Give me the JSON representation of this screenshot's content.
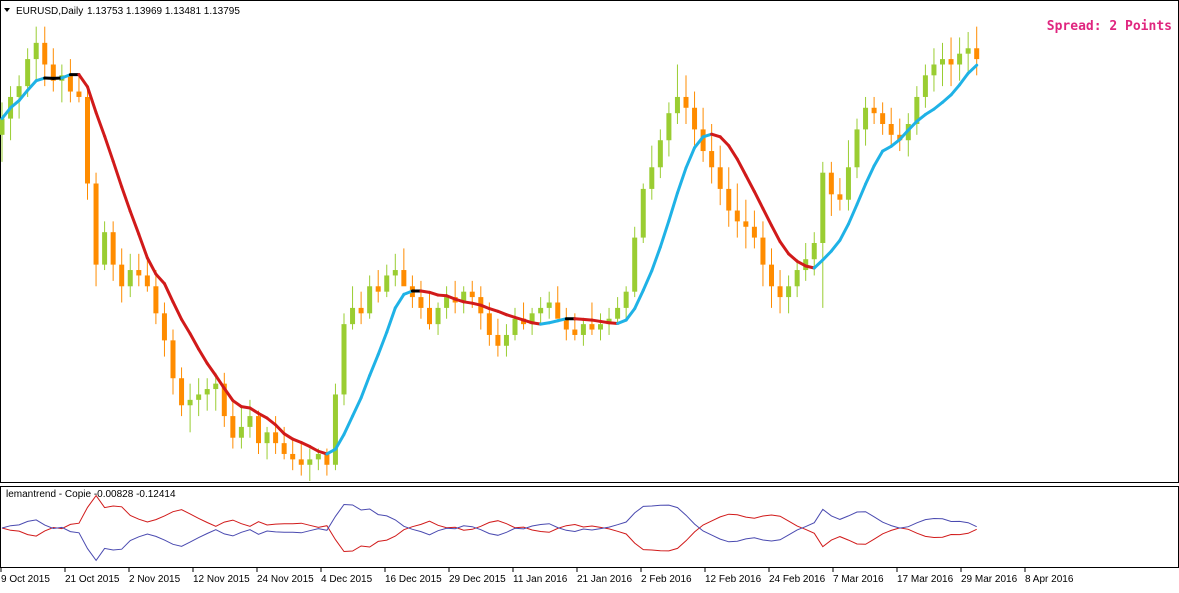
{
  "main_title": "EURUSD,Daily",
  "ohlc": "1.13753 1.13969 1.13481 1.13795",
  "spread_label": "Spread: 2 Points",
  "indicator_label": "lemantrend - Copie -0.00828 -0.12414",
  "x_ticks": [
    "9 Oct 2015",
    "21 Oct 2015",
    "2 Nov 2015",
    "12 Nov 2015",
    "24 Nov 2015",
    "4 Dec 2015",
    "16 Dec 2015",
    "29 Dec 2015",
    "11 Jan 2016",
    "21 Jan 2016",
    "2 Feb 2016",
    "12 Feb 2016",
    "24 Feb 2016",
    "7 Mar 2016",
    "17 Mar 2016",
    "29 Mar 2016",
    "8 Apr 2016"
  ],
  "colors": {
    "bull": "#9acd32",
    "bear": "#ff8c00",
    "ma_up": "#1fb2e6",
    "ma_down": "#d11a1a",
    "ma_flat": "#000000",
    "ind_red": "#d11a1a",
    "ind_blue": "#4a4ab0"
  },
  "chart_data": {
    "type": "candlestick",
    "symbol": "EURUSD",
    "timeframe": "Daily",
    "price_range": [
      1.06,
      1.148
    ],
    "candles": [
      [
        1.124,
        1.13,
        1.119,
        1.127
      ],
      [
        1.127,
        1.133,
        1.123,
        1.131
      ],
      [
        1.131,
        1.135,
        1.127,
        1.133
      ],
      [
        1.133,
        1.14,
        1.131,
        1.138
      ],
      [
        1.138,
        1.144,
        1.134,
        1.141
      ],
      [
        1.141,
        1.144,
        1.133,
        1.137
      ],
      [
        1.137,
        1.14,
        1.132,
        1.134
      ],
      [
        1.134,
        1.137,
        1.13,
        1.135
      ],
      [
        1.135,
        1.138,
        1.13,
        1.132
      ],
      [
        1.132,
        1.135,
        1.13,
        1.131
      ],
      [
        1.131,
        1.133,
        1.112,
        1.115
      ],
      [
        1.115,
        1.117,
        1.096,
        1.1
      ],
      [
        1.1,
        1.108,
        1.099,
        1.106
      ],
      [
        1.106,
        1.108,
        1.097,
        1.1
      ],
      [
        1.1,
        1.103,
        1.093,
        1.096
      ],
      [
        1.096,
        1.102,
        1.094,
        1.099
      ],
      [
        1.099,
        1.102,
        1.096,
        1.098
      ],
      [
        1.098,
        1.101,
        1.095,
        1.096
      ],
      [
        1.096,
        1.099,
        1.089,
        1.091
      ],
      [
        1.091,
        1.093,
        1.083,
        1.086
      ],
      [
        1.086,
        1.088,
        1.076,
        1.079
      ],
      [
        1.079,
        1.081,
        1.072,
        1.074
      ],
      [
        1.074,
        1.078,
        1.069,
        1.075
      ],
      [
        1.075,
        1.079,
        1.072,
        1.076
      ],
      [
        1.076,
        1.079,
        1.073,
        1.077
      ],
      [
        1.077,
        1.08,
        1.073,
        1.078
      ],
      [
        1.078,
        1.08,
        1.07,
        1.072
      ],
      [
        1.072,
        1.075,
        1.066,
        1.068
      ],
      [
        1.068,
        1.074,
        1.066,
        1.07
      ],
      [
        1.07,
        1.075,
        1.068,
        1.072
      ],
      [
        1.072,
        1.073,
        1.065,
        1.067
      ],
      [
        1.067,
        1.07,
        1.064,
        1.069
      ],
      [
        1.069,
        1.072,
        1.065,
        1.067
      ],
      [
        1.067,
        1.07,
        1.064,
        1.065
      ],
      [
        1.065,
        1.068,
        1.062,
        1.064
      ],
      [
        1.064,
        1.067,
        1.061,
        1.063
      ],
      [
        1.063,
        1.066,
        1.06,
        1.064
      ],
      [
        1.064,
        1.066,
        1.062,
        1.065
      ],
      [
        1.065,
        1.066,
        1.061,
        1.063
      ],
      [
        1.063,
        1.078,
        1.062,
        1.076
      ],
      [
        1.076,
        1.091,
        1.074,
        1.089
      ],
      [
        1.089,
        1.096,
        1.088,
        1.092
      ],
      [
        1.092,
        1.095,
        1.089,
        1.091
      ],
      [
        1.091,
        1.098,
        1.09,
        1.096
      ],
      [
        1.096,
        1.099,
        1.093,
        1.095
      ],
      [
        1.095,
        1.1,
        1.094,
        1.098
      ],
      [
        1.098,
        1.102,
        1.096,
        1.099
      ],
      [
        1.099,
        1.103,
        1.097,
        1.096
      ],
      [
        1.096,
        1.098,
        1.092,
        1.094
      ],
      [
        1.094,
        1.097,
        1.09,
        1.092
      ],
      [
        1.092,
        1.095,
        1.088,
        1.089
      ],
      [
        1.089,
        1.093,
        1.087,
        1.092
      ],
      [
        1.092,
        1.096,
        1.09,
        1.094
      ],
      [
        1.094,
        1.097,
        1.091,
        1.093
      ],
      [
        1.093,
        1.096,
        1.091,
        1.095
      ],
      [
        1.095,
        1.097,
        1.092,
        1.094
      ],
      [
        1.094,
        1.096,
        1.088,
        1.091
      ],
      [
        1.091,
        1.093,
        1.085,
        1.087
      ],
      [
        1.087,
        1.09,
        1.083,
        1.085
      ],
      [
        1.085,
        1.089,
        1.083,
        1.087
      ],
      [
        1.087,
        1.092,
        1.086,
        1.09
      ],
      [
        1.09,
        1.093,
        1.088,
        1.089
      ],
      [
        1.089,
        1.092,
        1.087,
        1.091
      ],
      [
        1.091,
        1.094,
        1.089,
        1.092
      ],
      [
        1.092,
        1.095,
        1.09,
        1.093
      ],
      [
        1.093,
        1.096,
        1.091,
        1.09
      ],
      [
        1.09,
        1.092,
        1.086,
        1.088
      ],
      [
        1.088,
        1.091,
        1.086,
        1.087
      ],
      [
        1.087,
        1.09,
        1.085,
        1.089
      ],
      [
        1.089,
        1.093,
        1.087,
        1.088
      ],
      [
        1.088,
        1.091,
        1.086,
        1.089
      ],
      [
        1.089,
        1.092,
        1.087,
        1.09
      ],
      [
        1.09,
        1.094,
        1.089,
        1.092
      ],
      [
        1.092,
        1.096,
        1.09,
        1.095
      ],
      [
        1.095,
        1.107,
        1.094,
        1.105
      ],
      [
        1.105,
        1.115,
        1.104,
        1.114
      ],
      [
        1.114,
        1.122,
        1.112,
        1.118
      ],
      [
        1.118,
        1.125,
        1.116,
        1.123
      ],
      [
        1.123,
        1.13,
        1.12,
        1.128
      ],
      [
        1.128,
        1.137,
        1.126,
        1.131
      ],
      [
        1.131,
        1.135,
        1.126,
        1.129
      ],
      [
        1.129,
        1.132,
        1.122,
        1.125
      ],
      [
        1.125,
        1.129,
        1.119,
        1.121
      ],
      [
        1.121,
        1.126,
        1.115,
        1.118
      ],
      [
        1.118,
        1.122,
        1.111,
        1.114
      ],
      [
        1.114,
        1.118,
        1.107,
        1.11
      ],
      [
        1.11,
        1.115,
        1.105,
        1.108
      ],
      [
        1.108,
        1.112,
        1.103,
        1.107
      ],
      [
        1.107,
        1.11,
        1.103,
        1.105
      ],
      [
        1.105,
        1.108,
        1.096,
        1.1
      ],
      [
        1.1,
        1.103,
        1.092,
        1.096
      ],
      [
        1.096,
        1.099,
        1.091,
        1.094
      ],
      [
        1.094,
        1.098,
        1.091,
        1.096
      ],
      [
        1.096,
        1.101,
        1.094,
        1.099
      ],
      [
        1.099,
        1.104,
        1.097,
        1.101
      ],
      [
        1.101,
        1.106,
        1.098,
        1.104
      ],
      [
        1.104,
        1.119,
        1.092,
        1.117
      ],
      [
        1.117,
        1.119,
        1.109,
        1.113
      ],
      [
        1.113,
        1.116,
        1.11,
        1.112
      ],
      [
        1.112,
        1.123,
        1.11,
        1.118
      ],
      [
        1.118,
        1.127,
        1.116,
        1.125
      ],
      [
        1.125,
        1.131,
        1.122,
        1.129
      ],
      [
        1.129,
        1.131,
        1.126,
        1.128
      ],
      [
        1.128,
        1.13,
        1.124,
        1.126
      ],
      [
        1.126,
        1.129,
        1.122,
        1.124
      ],
      [
        1.124,
        1.127,
        1.121,
        1.123
      ],
      [
        1.123,
        1.128,
        1.12,
        1.126
      ],
      [
        1.126,
        1.133,
        1.124,
        1.131
      ],
      [
        1.131,
        1.137,
        1.129,
        1.135
      ],
      [
        1.135,
        1.14,
        1.132,
        1.137
      ],
      [
        1.137,
        1.141,
        1.133,
        1.138
      ],
      [
        1.138,
        1.142,
        1.133,
        1.137
      ],
      [
        1.137,
        1.142,
        1.134,
        1.139
      ],
      [
        1.139,
        1.143,
        1.135,
        1.14
      ],
      [
        1.14,
        1.144,
        1.135,
        1.138
      ]
    ]
  }
}
